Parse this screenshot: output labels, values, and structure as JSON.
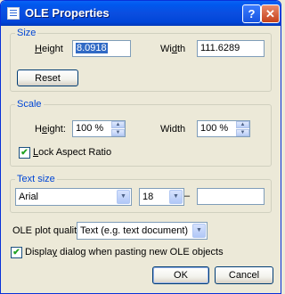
{
  "window": {
    "title": "OLE Properties",
    "help_label": "?",
    "close_label": "✕"
  },
  "size": {
    "legend": "Size",
    "height_label_pre": "",
    "height_label_key": "H",
    "height_label_post": "eight",
    "height_value": "8.0918",
    "width_label_pre": "Wi",
    "width_label_key": "d",
    "width_label_post": "th",
    "width_value": "111.6289",
    "reset_label": "Reset"
  },
  "scale": {
    "legend": "Scale",
    "height_label_pre": "H",
    "height_label_key": "e",
    "height_label_post": "ight:",
    "height_value": "100 %",
    "width_label": "Width",
    "width_value": "100 %",
    "lock_pre": "",
    "lock_key": "L",
    "lock_post": "ock Aspect Ratio",
    "lock_checked": "✔"
  },
  "text_size": {
    "legend": "Text size",
    "font_value": "Arial",
    "size_value": "18",
    "dash": "–",
    "extra_value": ""
  },
  "plot_quality": {
    "label": "OLE plot quality",
    "value": "Text (e.g. text document)"
  },
  "display_dialog": {
    "pre": "Displa",
    "key": "y",
    "post": " dialog when pasting new OLE objects",
    "checked": "✔"
  },
  "buttons": {
    "ok": "OK",
    "cancel": "Cancel"
  }
}
